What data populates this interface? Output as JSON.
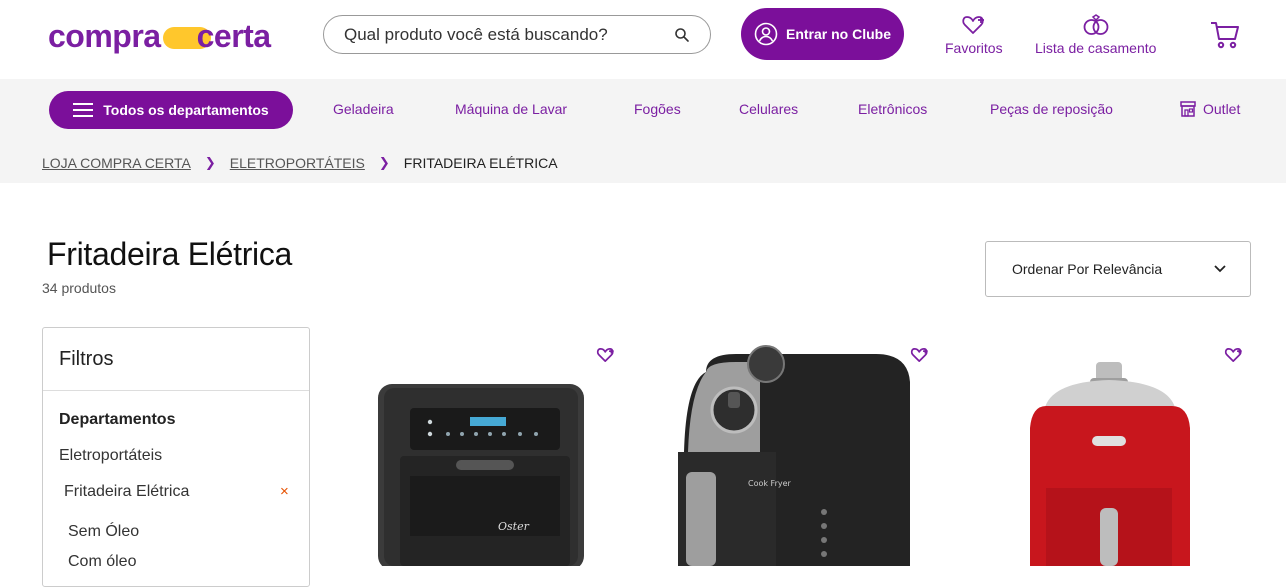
{
  "header": {
    "logo_part1": "compra",
    "logo_part2": "certa",
    "search_placeholder": "Qual produto você está buscando?",
    "club_label": "Entrar no Clube",
    "favorites_label": "Favoritos",
    "wedding_label": "Lista de casamento"
  },
  "nav": {
    "departments_label": "Todos os departamentos",
    "items": [
      "Geladeira",
      "Máquina de Lavar",
      "Fogões",
      "Celulares",
      "Eletrônicos",
      "Peças de reposição",
      "Outlet"
    ]
  },
  "breadcrumb": {
    "items": [
      "LOJA COMPRA CERTA",
      "ELETROPORTÁTEIS",
      "FRITADEIRA ELÉTRICA"
    ]
  },
  "page": {
    "title": "Fritadeira Elétrica",
    "count": "34 produtos",
    "sort_label": "Ordenar Por Relevância"
  },
  "filters": {
    "title": "Filtros",
    "section": "Departamentos",
    "items": [
      "Eletroportáteis",
      "Fritadeira Elétrica",
      "Sem Óleo",
      "Com óleo"
    ],
    "remove_symbol": "×"
  },
  "products": [
    {
      "brand_text": "Oster",
      "color": "#3a3a3a"
    },
    {
      "brand_text": "Cook Fryer",
      "color": "#1e1e1e"
    },
    {
      "brand_text": "",
      "color": "#c8161d"
    }
  ],
  "colors": {
    "brand_purple": "#7b0f9a",
    "logo_yellow": "#ffc72c",
    "nav_bg": "#f4f4f4"
  }
}
